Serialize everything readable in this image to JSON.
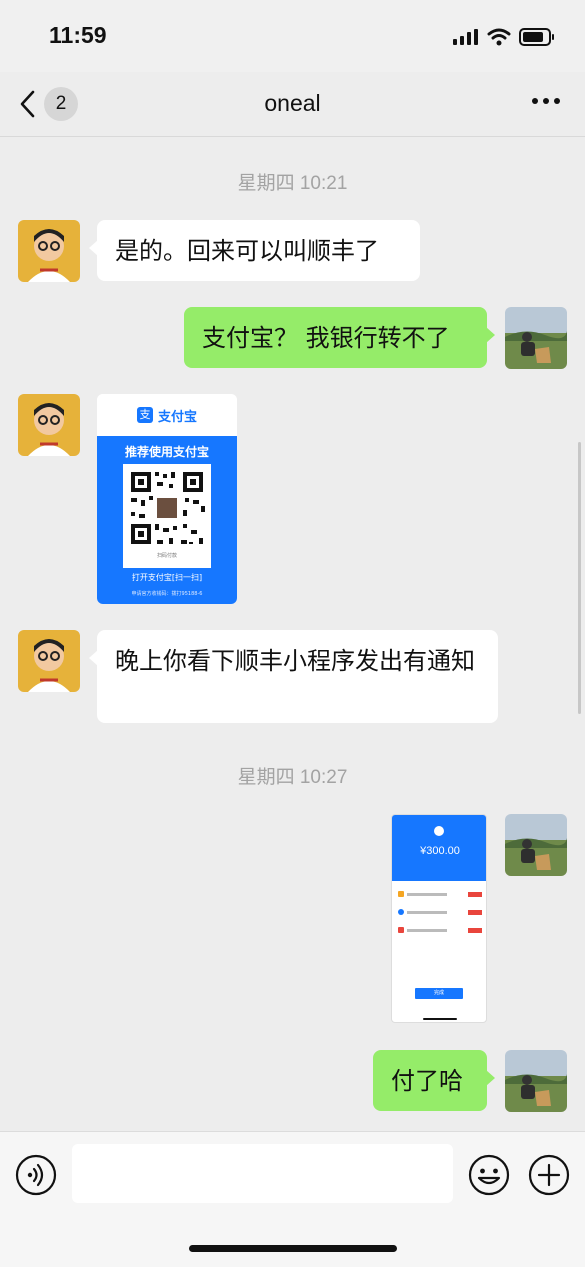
{
  "status": {
    "time": "11:59"
  },
  "nav": {
    "title": "oneal",
    "unread_count": "2"
  },
  "messages": [
    {
      "type": "timestamp",
      "text": "星期四 10:21"
    },
    {
      "type": "text",
      "side": "left",
      "text": "是的。回来可以叫顺丰了"
    },
    {
      "type": "text",
      "side": "right",
      "text": "支付宝？ 我银行转不了"
    },
    {
      "type": "image",
      "side": "left",
      "card": {
        "brand": "支付宝",
        "heading": "推荐使用支付宝",
        "qr_caption": "扫码付款",
        "open_label": "打开支付宝[扫一扫]",
        "footer": "申请官方收钱码：拨打95188-6"
      }
    },
    {
      "type": "text",
      "side": "left",
      "text": "晚上你看下顺丰小程序发出有通知"
    },
    {
      "type": "timestamp",
      "text": "星期四 10:27"
    },
    {
      "type": "image",
      "side": "right",
      "screenshot": {
        "amount": "¥300.00",
        "button": "完成"
      }
    },
    {
      "type": "text",
      "side": "right",
      "text": "付了哈"
    }
  ],
  "colors": {
    "self_bubble": "#95ec69",
    "other_bubble": "#ffffff",
    "background": "#ededed",
    "alipay_blue": "#1677ff"
  },
  "icons": [
    "chevron-left-icon",
    "more-icon",
    "voice-icon",
    "emoji-icon",
    "plus-icon",
    "signal-icon",
    "wifi-icon",
    "battery-icon"
  ]
}
